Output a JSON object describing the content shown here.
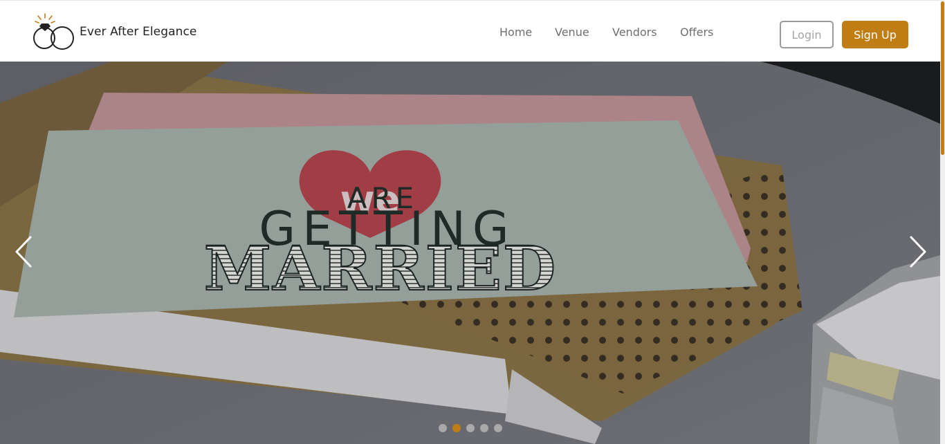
{
  "brand": {
    "name": "Ever After Elegance",
    "logo_icon": "wedding-rings-icon"
  },
  "nav": {
    "links": [
      {
        "label": "Home"
      },
      {
        "label": "Venue"
      },
      {
        "label": "Vendors"
      },
      {
        "label": "Offers"
      }
    ],
    "login_label": "Login",
    "signup_label": "Sign Up"
  },
  "hero": {
    "card_text": {
      "line1": "we",
      "line2": "ARE",
      "line3": "GETTING",
      "line4": "MARRIED"
    },
    "prev_icon": "chevron-left-icon",
    "next_icon": "chevron-right-icon",
    "slide_count": 5,
    "active_slide": 2
  },
  "colors": {
    "accent": "#c07d13",
    "nav_text": "#6f6f6f",
    "brand_text": "#222222"
  }
}
